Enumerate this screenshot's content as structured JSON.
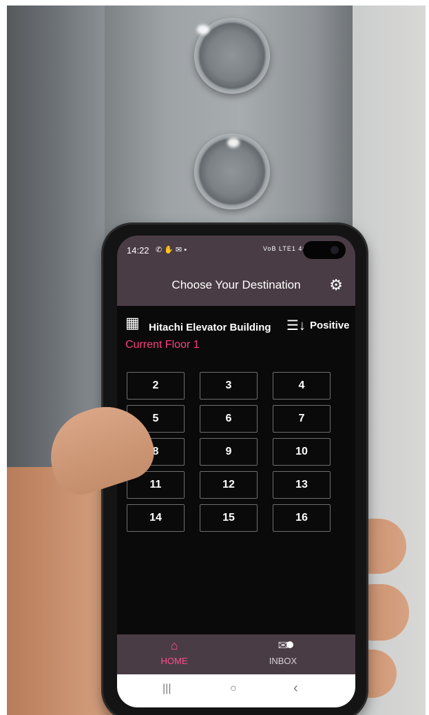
{
  "status_bar": {
    "time": "14:22",
    "system_icons": "✆ ✋ ✉ •",
    "network": "VoB LTE1 4G ıl ▮"
  },
  "app_bar": {
    "title": "Choose Your Destination",
    "settings_icon": "gear-icon"
  },
  "building": {
    "name": "Hitachi Elevator Building",
    "icon": "building-icon"
  },
  "sort": {
    "label": "Positive",
    "icon": "sort-descending-icon"
  },
  "current_floor": "Current Floor 1",
  "floors": [
    "2",
    "3",
    "4",
    "5",
    "6",
    "7",
    "8",
    "9",
    "10",
    "11",
    "12",
    "13",
    "14",
    "15",
    "16"
  ],
  "bottom_nav": {
    "home": {
      "label": "HOME",
      "icon": "home-icon"
    },
    "inbox": {
      "label": "INBOX",
      "icon": "mail-icon"
    }
  },
  "system_nav": {
    "recents": "|||",
    "home": "○",
    "back": "‹"
  },
  "colors": {
    "accent": "#ff3f7f",
    "bar": "#4a3c45",
    "background": "#0b0a0b"
  }
}
